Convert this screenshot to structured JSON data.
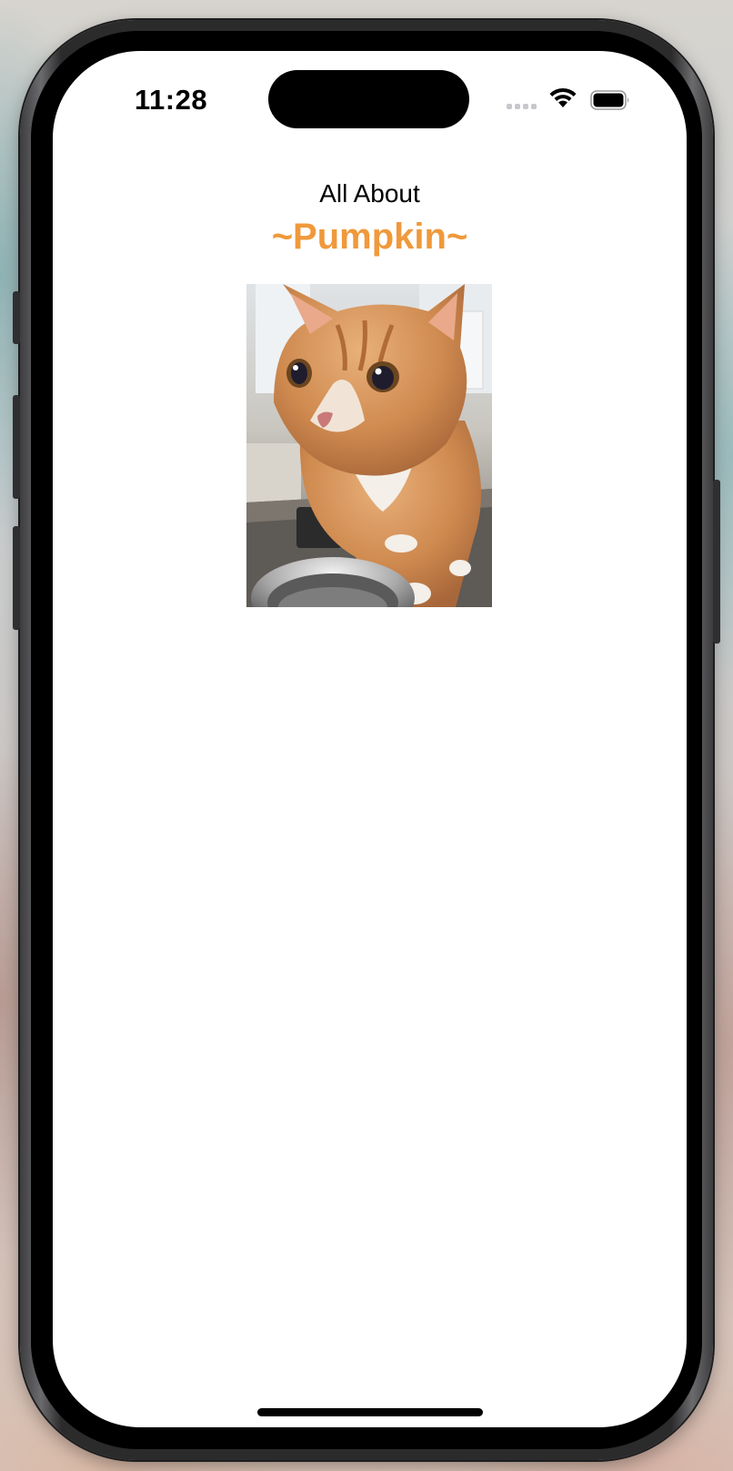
{
  "status_bar": {
    "time": "11:28",
    "icons": [
      "cellular-signal-icon",
      "wifi-icon",
      "battery-icon"
    ]
  },
  "header": {
    "subtitle": "All About",
    "title": "~Pumpkin~",
    "title_color": "#f0993b"
  },
  "photo": {
    "subject": "orange tabby cat"
  },
  "colors": {
    "accent": "#f0993b",
    "screen_background": "#ffffff"
  }
}
